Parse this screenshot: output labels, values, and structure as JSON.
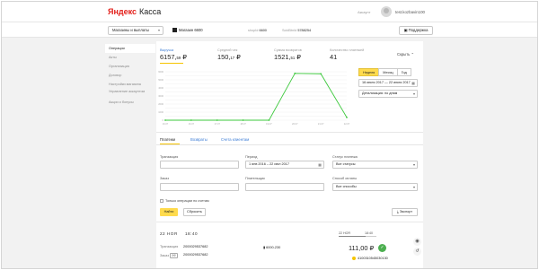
{
  "header": {
    "logo_brand": "Яндекс",
    "logo_product": "Касса",
    "switch_label": "Аккаунт",
    "user_login": "test.kozbavin100"
  },
  "toolbar": {
    "shop_select": "Магазины и выплаты",
    "store_name": "Магазин 6600",
    "shop_id_label": "shopId",
    "shop_id_value": "6600",
    "scid_label": "ScidBtnId",
    "scid_value": "5788254",
    "support_label": "Поддержка"
  },
  "nav": {
    "items": [
      {
        "label": "Операции",
        "active": true
      },
      {
        "label": "Акты",
        "active": false
      },
      {
        "label": "Организация",
        "active": false
      },
      {
        "label": "Договор",
        "active": false
      },
      {
        "label": "Настройки магазина",
        "active": false
      },
      {
        "label": "Управление аккаунтом",
        "active": false
      },
      {
        "label": "Акции и бонусы",
        "active": false
      }
    ]
  },
  "metrics": [
    {
      "label": "Выручка",
      "whole": "6157,",
      "cents": "59",
      "currency": "₽",
      "active": true
    },
    {
      "label": "Средний чек",
      "whole": "150,",
      "cents": "17",
      "currency": "₽",
      "active": false
    },
    {
      "label": "Сумма возвратов",
      "whole": "1521,",
      "cents": "51",
      "currency": "₽",
      "active": false
    },
    {
      "label": "Количество платежей",
      "whole": "41",
      "cents": "",
      "currency": "",
      "active": false
    }
  ],
  "collapse_label": "Скрыть",
  "period": {
    "options": [
      "Неделя",
      "Месяц",
      "Год"
    ],
    "selected": "Неделя",
    "range": "16 июля 2017 — 22 июля 2017",
    "detail": "Детализация: по дням"
  },
  "chart_data": {
    "type": "line",
    "x": [
      "16.07",
      "16.07",
      "17.07",
      "18.07",
      "19.07",
      "20.07",
      "21.07",
      "22.07"
    ],
    "series": [
      {
        "values": [
          0,
          0,
          0,
          0,
          0,
          5800,
          5750,
          350
        ],
        "color": "#3cc83c"
      }
    ],
    "yticks": [
      0,
      500,
      1000,
      1500,
      2000,
      2500,
      3000,
      3500,
      4000,
      4500,
      5000,
      5500,
      6000
    ],
    "ylim": [
      0,
      6000
    ],
    "grid": true
  },
  "tabs": [
    {
      "label": "Платежи",
      "active": true
    },
    {
      "label": "Возвраты",
      "active": false
    },
    {
      "label": "Счета клиентам",
      "active": false
    }
  ],
  "filters": {
    "transaction_label": "Транзакция",
    "transaction_value": "",
    "period_label": "Период",
    "period_value": "1 янв 2016 – 22 июл 2017",
    "status_label": "Статус платежа",
    "status_value": "Все статусы",
    "order_label": "Заказ",
    "order_value": "",
    "payer_label": "Плательщик",
    "payer_value": "",
    "method_label": "Способ оплаты",
    "method_value": "Все способы",
    "test_only_label": "Только операции по счетам",
    "find_label": "Найти",
    "reset_label": "Сбросить",
    "export_label": "Экспорт"
  },
  "transaction": {
    "date": "22 НОЯ",
    "time": "18:40",
    "small_date": "22 НОЯ",
    "small_time": "18:40",
    "transaction_label": "Транзакция",
    "transaction_value": "2000029537682",
    "order_label": "Заказ",
    "order_chip": "ФФ",
    "order_value": "2000029537682",
    "amount_range": "6000-230",
    "amount": "111,00 ₽",
    "card": "4100310545030130"
  }
}
